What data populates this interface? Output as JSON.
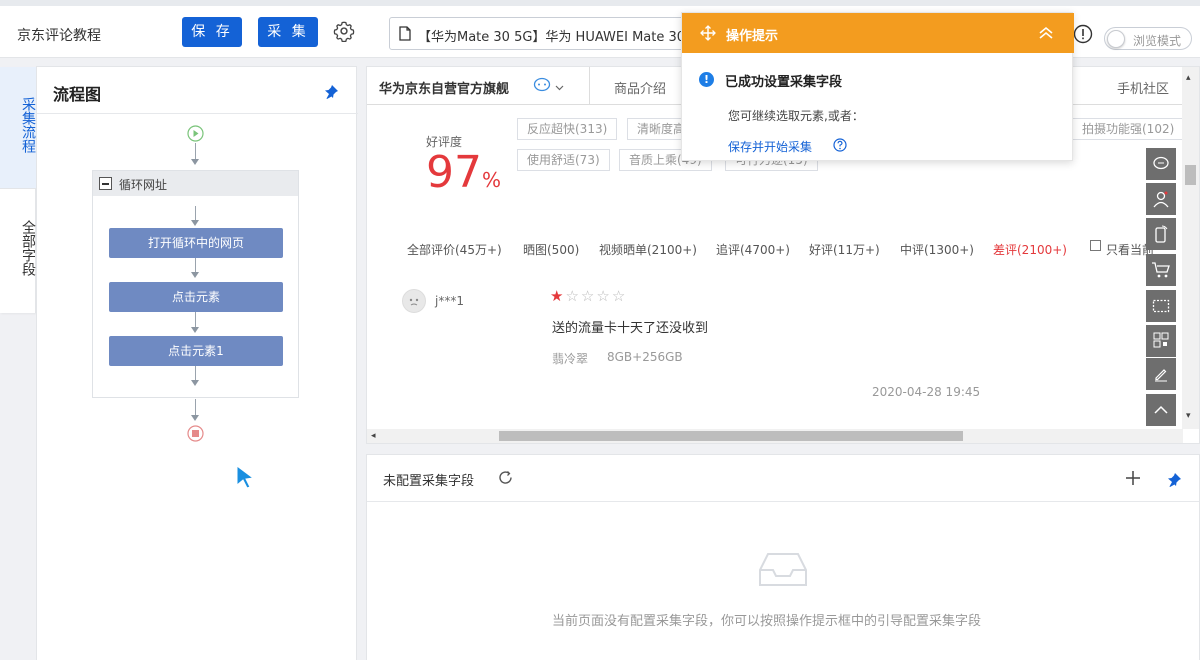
{
  "app": {
    "title": "京东评论教程",
    "save_label": "保 存",
    "collect_label": "采 集",
    "url_text": "【华为Mate 30 5G】华为 HUAWEI Mate 30",
    "browse_mode_label": "浏览模式"
  },
  "vtabs": [
    {
      "label": "采集流程"
    },
    {
      "label": "全部字段"
    }
  ],
  "flow": {
    "title": "流程图",
    "loop_label": "循环网址",
    "nodes": [
      "打开循环中的网页",
      "点击元素",
      "点击元素1"
    ]
  },
  "browser": {
    "shop_name": "华为京东自营官方旗舰",
    "tabs": [
      "商品介绍",
      "手机社区"
    ],
    "rating_label": "好评度",
    "rating_value": "97",
    "rating_unit": "%",
    "tags_row1": [
      "反应超快(313)",
      "清晰度高",
      "拍摄功能强(102)"
    ],
    "tags_row2": [
      "使用舒适(73)",
      "音质上乘(49)",
      "可行力逐(15)"
    ],
    "filters": [
      "全部评价(45万+)",
      "晒图(500)",
      "视频晒单(2100+)",
      "追评(4700+)",
      "好评(11万+)",
      "中评(1300+)",
      "差评(2100+)",
      "只看当前"
    ],
    "review": {
      "user": "j***1",
      "stars": 1,
      "text": "送的流量卡十天了还没收到",
      "color": "翡冷翠",
      "spec": "8GB+256GB",
      "date": "2020-04-28 19:45"
    }
  },
  "fields_panel": {
    "title": "未配置采集字段",
    "empty_message": "当前页面没有配置采集字段，你可以按照操作提示框中的引导配置采集字段"
  },
  "tip": {
    "title": "操作提示",
    "success": "已成功设置采集字段",
    "next": "您可继续选取元素,或者：",
    "link": "保存并开始采集"
  },
  "colors": {
    "primary": "#1462d6",
    "warning": "#f39c1f",
    "danger": "#e4393c",
    "node": "#6f8ac2"
  }
}
